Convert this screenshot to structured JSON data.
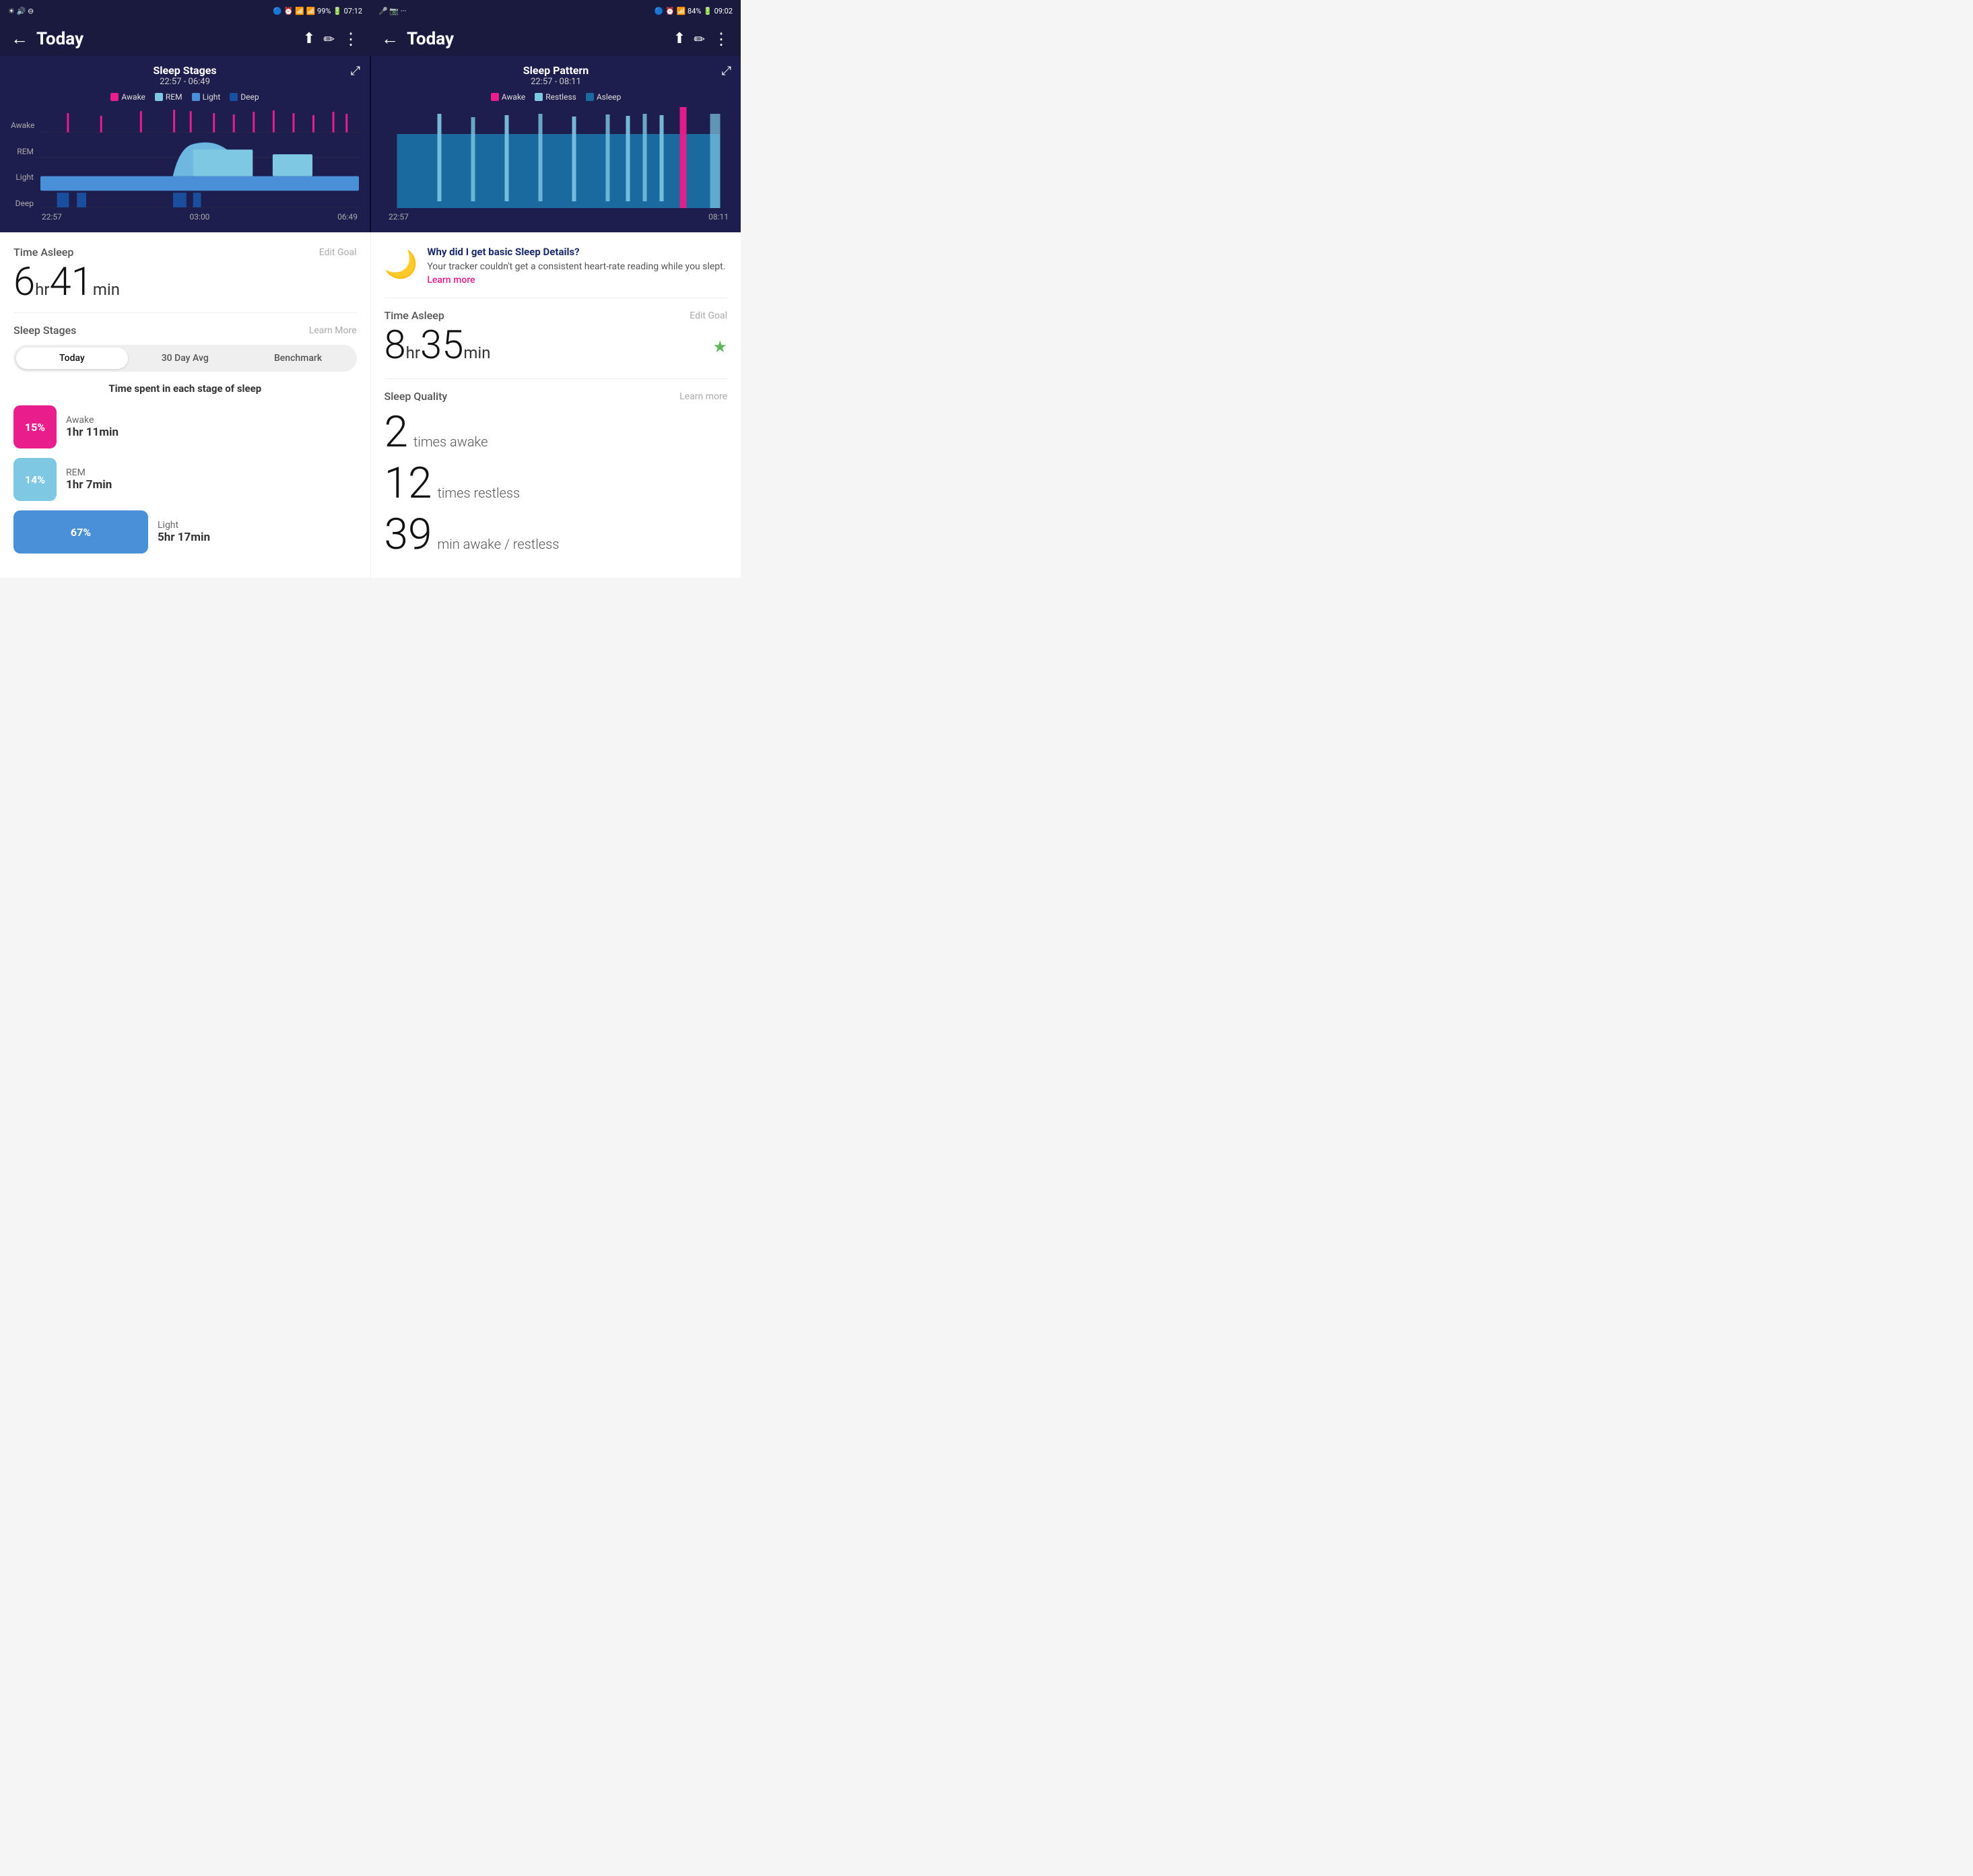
{
  "left": {
    "statusBar": {
      "leftIcons": "☀ 🔊 ⊖",
      "rightIcons": "🔵 ⏰ 📶 📶 99% 🔋 07:12"
    },
    "header": {
      "title": "Today",
      "backLabel": "←",
      "shareLabel": "⬆",
      "editLabel": "✏",
      "moreLabel": "⋮"
    },
    "chart": {
      "title": "Sleep Stages",
      "subtitle": "22:57 - 06:49",
      "legend": [
        {
          "color": "#e91e8c",
          "label": "Awake"
        },
        {
          "color": "#7ec8e3",
          "label": "REM"
        },
        {
          "color": "#4a90d9",
          "label": "Light"
        },
        {
          "color": "#1a4fa0",
          "label": "Deep"
        }
      ],
      "yLabels": [
        "Awake",
        "REM",
        "Light",
        "Deep"
      ],
      "xLabels": [
        "22:57",
        "03:00",
        "06:49"
      ]
    },
    "timeAsleep": {
      "sectionTitle": "Time Asleep",
      "editGoalLabel": "Edit Goal",
      "hours": "6",
      "hrUnit": "hr",
      "minutes": "41",
      "minUnit": "min"
    },
    "sleepStages": {
      "sectionTitle": "Sleep Stages",
      "learnMoreLabel": "Learn More",
      "tabs": [
        "Today",
        "30 Day Avg",
        "Benchmark"
      ],
      "activeTab": 0,
      "subTitle": "Time spent in each stage of sleep",
      "stages": [
        {
          "color": "#e91e8c",
          "percent": "15%",
          "name": "Awake",
          "time": "1hr 11min",
          "wide": false
        },
        {
          "color": "#7ec8e3",
          "percent": "14%",
          "name": "REM",
          "time": "1hr 7min",
          "wide": false
        },
        {
          "color": "#4a90d9",
          "percent": "67%",
          "name": "Light",
          "time": "5hr 17min",
          "wide": true
        }
      ]
    }
  },
  "right": {
    "statusBar": {
      "leftIcons": "🎤 📷 ···",
      "rightIcons": "🔵 ⏰ 📶 84% 🔋 09:02"
    },
    "header": {
      "title": "Today",
      "backLabel": "←",
      "shareLabel": "⬆",
      "editLabel": "✏",
      "moreLabel": "⋮"
    },
    "chart": {
      "title": "Sleep Pattern",
      "subtitle": "22:57 - 08:11",
      "legend": [
        {
          "color": "#e91e8c",
          "label": "Awake"
        },
        {
          "color": "#7ec8e3",
          "label": "Restless"
        },
        {
          "color": "#1a6aa0",
          "label": "Asleep"
        }
      ],
      "xLabels": [
        "22:57",
        "08:11"
      ]
    },
    "infoBox": {
      "title": "Why did I get basic Sleep Details?",
      "desc": "Your tracker couldn't get a consistent heart-rate reading while you slept.",
      "linkText": "Learn more"
    },
    "timeAsleep": {
      "sectionTitle": "Time Asleep",
      "editGoalLabel": "Edit Goal",
      "hours": "8",
      "hrUnit": "hr",
      "minutes": "35",
      "minUnit": "min"
    },
    "sleepQuality": {
      "sectionTitle": "Sleep Quality",
      "learnMoreLabel": "Learn more",
      "timesAwake": "2",
      "timesAwakeLabel": "times awake",
      "timesRestless": "12",
      "timesRestlessLabel": "times restless",
      "minAwakeRestless": "39",
      "minAwakeRestlessLabel": "min awake / restless"
    }
  }
}
